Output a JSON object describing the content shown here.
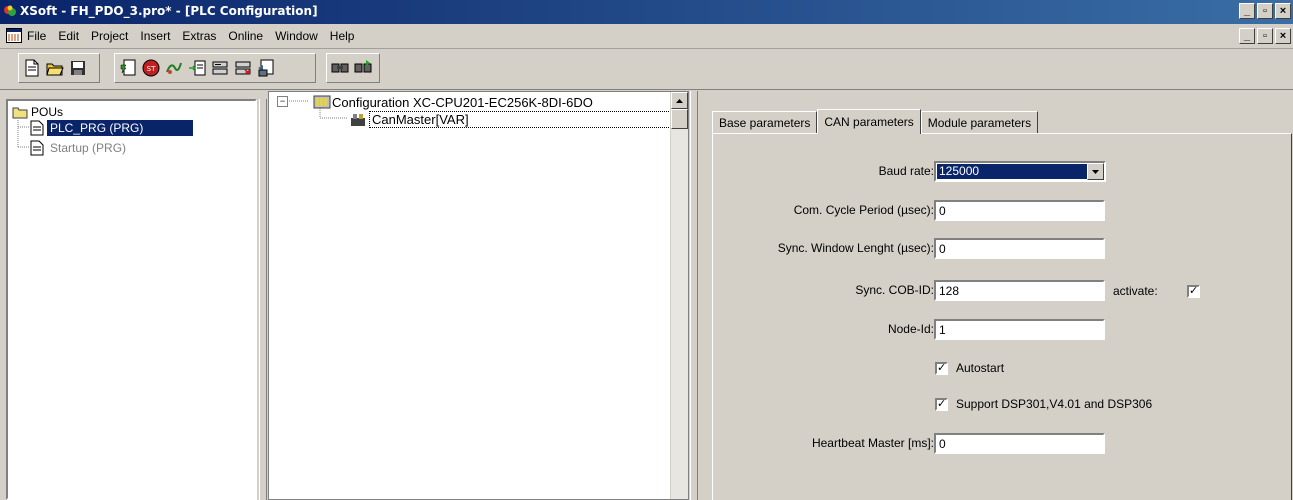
{
  "window": {
    "title": "XSoft - FH_PDO_3.pro* - [PLC Configuration]",
    "controls": {
      "minimize": "_",
      "restore": "▫",
      "close": "×"
    }
  },
  "menu": {
    "items": [
      "File",
      "Edit",
      "Project",
      "Insert",
      "Extras",
      "Online",
      "Window",
      "Help"
    ]
  },
  "toolbar": {
    "icons": [
      "new-file-icon",
      "open-folder-icon",
      "save-icon",
      "compile-icon",
      "stop-icon",
      "run-icon",
      "single-step-icon",
      "login-icon",
      "logout-icon",
      "find-icon",
      "replace-icon",
      "find-next-icon"
    ]
  },
  "pou_tree": {
    "root": "POUs",
    "items": [
      {
        "label": "PLC_PRG (PRG)",
        "selected": true
      },
      {
        "label": "Startup (PRG)",
        "selected": false
      }
    ]
  },
  "config_tree": {
    "root": "Configuration XC-CPU201-EC256K-8DI-6DO",
    "child": "CanMaster[VAR]"
  },
  "tabs": [
    {
      "label": "Base parameters",
      "active": false
    },
    {
      "label": "CAN parameters",
      "active": true
    },
    {
      "label": "Module parameters",
      "active": false
    }
  ],
  "form": {
    "baud_rate_label": "Baud rate:",
    "baud_rate_value": "125000",
    "com_cycle_label": "Com. Cycle Period (µsec):",
    "com_cycle_value": "0",
    "sync_window_label": "Sync. Window Lenght (µsec):",
    "sync_window_value": "0",
    "sync_cobid_label": "Sync. COB-ID:",
    "sync_cobid_value": "128",
    "activate_label": "activate:",
    "activate_checked": true,
    "node_id_label": "Node-Id:",
    "node_id_value": "1",
    "autostart_label": "Autostart",
    "autostart_checked": true,
    "support_label": "Support DSP301,V4.01 and DSP306",
    "support_checked": true,
    "heartbeat_label": "Heartbeat Master [ms]:",
    "heartbeat_value": "0"
  }
}
